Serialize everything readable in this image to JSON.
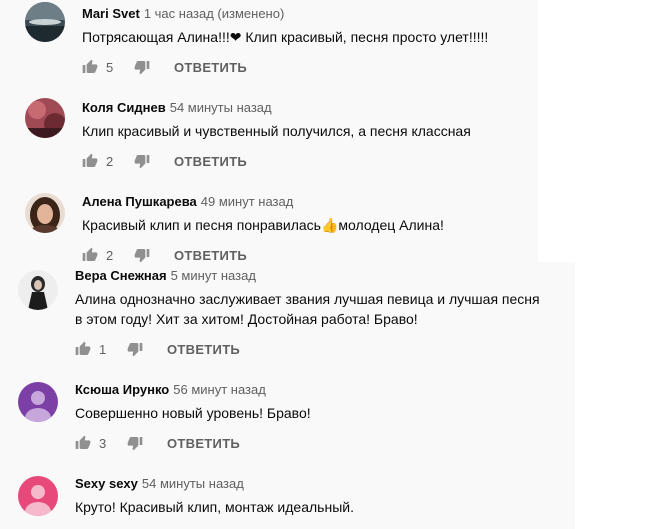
{
  "reply_label": "ОТВЕТИТЬ",
  "comments": [
    {
      "author": "Mari Svet",
      "time": "1 час назад (изменено)",
      "text": "Потрясающая Алина!!!❤ Клип красивый, песня просто улет!!!!!",
      "likes": "5",
      "avatar_color": "#3c4b52"
    },
    {
      "author": "Коля Сиднев",
      "time": "54 минуты назад",
      "text": "Клип красивый и чувственный получился, а песня классная",
      "likes": "2",
      "avatar_color": "#a04a55"
    },
    {
      "author": "Алена Пушкарева",
      "time": "49 минут назад",
      "text": "Красивый клип и песня понравилась👍молодец Алина!",
      "likes": "2",
      "avatar_color": "#5a3a2e"
    },
    {
      "author": "Вера Снежная",
      "time": "5 минут назад",
      "text": "Алина однозначно заслуживает звания лучшая певица и лучшая песня в этом году! Хит за хитом! Достойная работа! Браво!",
      "likes": "1",
      "avatar_color": "#e8e8e8"
    },
    {
      "author": "Ксюша Ирунко",
      "time": "56 минут назад",
      "text": "Совершенно новый уровень! Браво!",
      "likes": "3",
      "avatar_color": "#7b3fa6"
    },
    {
      "author": "Sexy sexy",
      "time": "54 минуты назад",
      "text": "Круто! Красивый клип, монтаж идеальный.",
      "likes": "",
      "avatar_color": "#e8497b"
    }
  ]
}
